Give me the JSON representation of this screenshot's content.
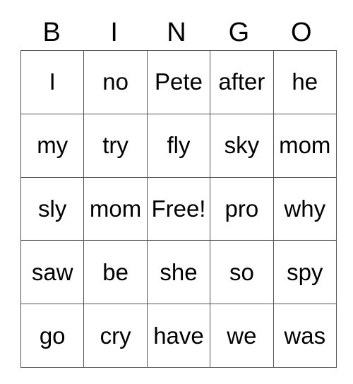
{
  "card": {
    "title": "BINGO",
    "headers": [
      "B",
      "I",
      "N",
      "G",
      "O"
    ],
    "free_space_label": "Free!",
    "rows": [
      [
        "I",
        "no",
        "Pete",
        "after",
        "he"
      ],
      [
        "my",
        "try",
        "fly",
        "sky",
        "mom"
      ],
      [
        "sly",
        "mom",
        "Free!",
        "pro",
        "why"
      ],
      [
        "saw",
        "be",
        "she",
        "so",
        "spy"
      ],
      [
        "go",
        "cry",
        "have",
        "we",
        "was"
      ]
    ],
    "colors": {
      "background": "#ffffff",
      "text": "#000000",
      "border": "#555555"
    }
  }
}
